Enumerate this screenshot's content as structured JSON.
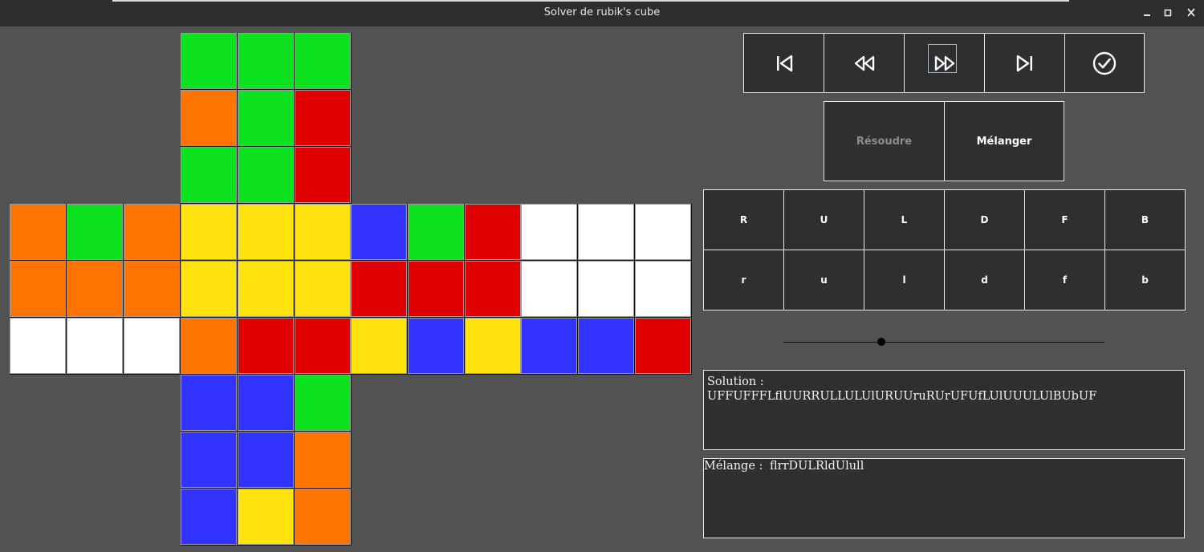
{
  "window": {
    "title": "Solver de rubik's cube",
    "controls": {
      "minimize": "✕",
      "maximize": "□",
      "close": "✕"
    }
  },
  "colors": {
    "G": "#0ce21f",
    "O": "#ff7300",
    "R": "#e00000",
    "Y": "#ffe20e",
    "B": "#3333ff",
    "W": "#ffffff"
  },
  "cube": {
    "top": [
      [
        "G",
        "G",
        "G"
      ],
      [
        "O",
        "G",
        "R"
      ],
      [
        "G",
        "G",
        "R"
      ]
    ],
    "left": [
      [
        "O",
        "G",
        "O"
      ],
      [
        "O",
        "O",
        "O"
      ],
      [
        "W",
        "W",
        "W"
      ]
    ],
    "front": [
      [
        "Y",
        "Y",
        "Y"
      ],
      [
        "Y",
        "Y",
        "Y"
      ],
      [
        "O",
        "R",
        "R"
      ]
    ],
    "right": [
      [
        "B",
        "G",
        "R"
      ],
      [
        "R",
        "R",
        "R"
      ],
      [
        "Y",
        "B",
        "Y"
      ]
    ],
    "back": [
      [
        "W",
        "W",
        "W"
      ],
      [
        "W",
        "W",
        "W"
      ],
      [
        "B",
        "B",
        "R"
      ]
    ],
    "bottom": [
      [
        "B",
        "B",
        "G"
      ],
      [
        "B",
        "B",
        "O"
      ],
      [
        "B",
        "Y",
        "O"
      ]
    ]
  },
  "playback": [
    "skip-to-start-icon",
    "rewind-icon",
    "fast-forward-icon",
    "skip-to-end-icon",
    "check-circle-icon"
  ],
  "actions": {
    "solve": "Résoudre",
    "shuffle": "Mélanger"
  },
  "moves": {
    "row1": [
      "R",
      "U",
      "L",
      "D",
      "F",
      "B"
    ],
    "row2": [
      "r",
      "u",
      "l",
      "d",
      "f",
      "b"
    ]
  },
  "speed_slider": {
    "value": 0.305
  },
  "solution": {
    "label": "Solution :",
    "value": "UFFUFFFLflUURRULLULUlURUUruRUrUFUfLUlUUULUlBUbUF"
  },
  "shuffle_box": {
    "label": "Mélange :",
    "value": "flrrDULRldUlull"
  }
}
